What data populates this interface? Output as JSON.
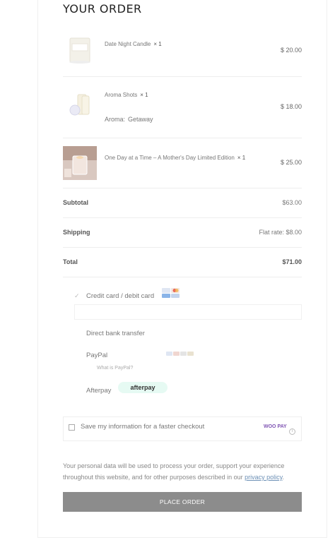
{
  "title": "YOUR ORDER",
  "items": [
    {
      "name": "Date Night Candle",
      "qty": "×  1",
      "price": "$ 20.00",
      "attr_label": "",
      "attr_value": ""
    },
    {
      "name": "Aroma Shots",
      "qty": "×  1",
      "price": "$ 18.00",
      "attr_label": "Aroma:",
      "attr_value": "Getaway"
    },
    {
      "name": "One Day at a Time – A Mother's Day Limited Edition",
      "qty": "×  1",
      "price": "$ 25.00",
      "attr_label": "",
      "attr_value": ""
    }
  ],
  "totals": {
    "subtotal_label": "Subtotal",
    "subtotal_value": "$63.00",
    "shipping_label": "Shipping",
    "shipping_value": "Flat rate: $8.00",
    "total_label": "Total",
    "total_value": "$71.00"
  },
  "payment": {
    "credit_card": "Credit card / debit card",
    "bank": "Direct bank transfer",
    "paypal": "PayPal",
    "paypal_link": "What is PayPal?",
    "afterpay": "Afterpay",
    "afterpay_logo": "afterpay",
    "selected_check": "✓"
  },
  "save_info": {
    "label": "Save my information for a faster checkout",
    "woo_logo": "WOO PAY",
    "info_icon": "i"
  },
  "privacy": {
    "text": "Your personal data will be used to process your order, support your experience throughout this website, and for other purposes described in our ",
    "link": "privacy policy",
    "end": "."
  },
  "button": "PLACE ORDER",
  "colors": {
    "button_bg": "#8c8c8c",
    "afterpay_bg": "#e6faf3",
    "link": "#6b8fb5"
  }
}
